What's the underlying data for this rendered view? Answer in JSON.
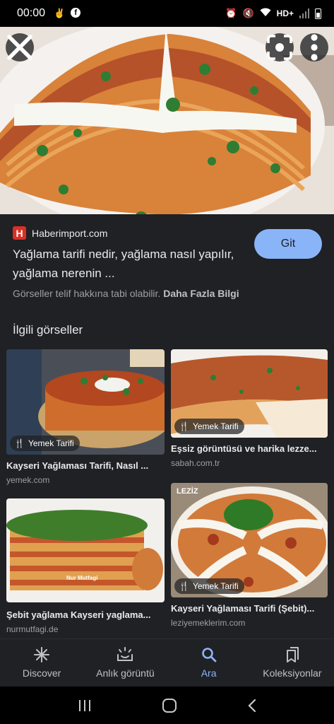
{
  "status_bar": {
    "time": "00:00",
    "network": "HD+"
  },
  "hero": {
    "close_icon": "close-icon",
    "lens_icon": "lens-icon",
    "more_icon": "more-vert-icon"
  },
  "result": {
    "favicon_letter": "H",
    "site": "Haberimport.com",
    "title": "Yağlama tarifi nedir, yağlama nasıl yapılır, yağlama nerenin ...",
    "go_label": "Git",
    "copyright_text": "Görseller telif hakkına tabi olabilir.",
    "more_info_label": "Daha Fazla Bilgi"
  },
  "related": {
    "heading": "İlgili görseller",
    "cards": [
      {
        "badge": "Yemek Tarifi",
        "title": "Kayseri Yağlaması Tarifi, Nasıl ...",
        "source": "yemek.com"
      },
      {
        "badge": "Yemek Tarifi",
        "title": "Eşsiz görüntüsü ve harika lezze...",
        "source": "sabah.com.tr"
      },
      {
        "badge": "",
        "title": "Şebit yağlama Kayseri yaglama...",
        "source": "nurmutfagi.de",
        "watermark": "Nur Mutfagi"
      },
      {
        "badge": "Yemek Tarifi",
        "title": "Kayseri Yağlaması Tarifi (Şebit)...",
        "source": "leziyemeklerim.com",
        "watermark": "LEZİZ"
      }
    ]
  },
  "bottom_nav": {
    "items": [
      {
        "label": "Discover",
        "icon": "asterisk-icon"
      },
      {
        "label": "Anlık görüntü",
        "icon": "snapshot-icon"
      },
      {
        "label": "Ara",
        "icon": "search-icon",
        "active": true
      },
      {
        "label": "Koleksiyonlar",
        "icon": "collections-icon"
      }
    ]
  },
  "colors": {
    "background": "#202124",
    "accent": "#8ab4f8",
    "favicon": "#d93025"
  }
}
